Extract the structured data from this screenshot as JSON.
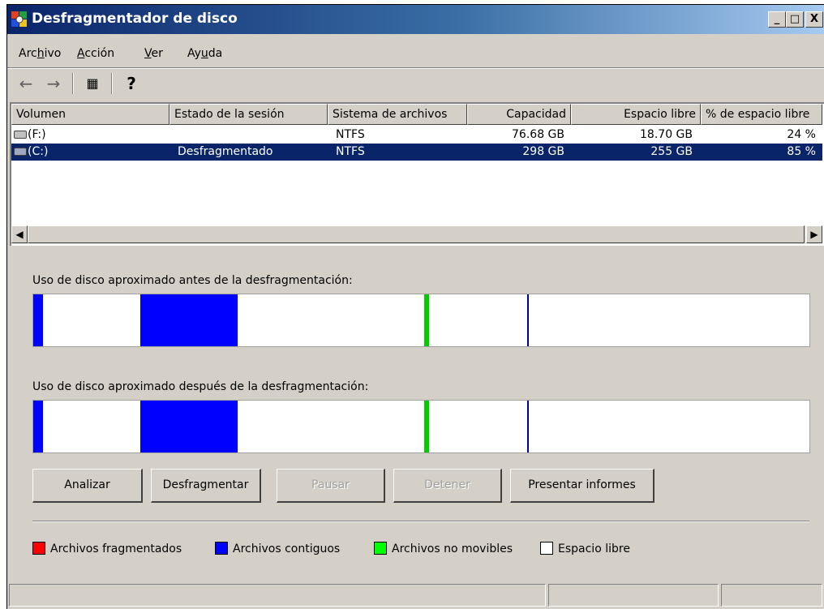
{
  "window": {
    "title": "Desfragmentador de disco",
    "controls": {
      "minimize": "_",
      "maximize": "□",
      "close": "X"
    }
  },
  "menu": [
    {
      "pre": "Arc",
      "u": "h",
      "post": "ivo"
    },
    {
      "pre": "",
      "u": "A",
      "post": "cción"
    },
    {
      "pre": "",
      "u": "V",
      "post": "er"
    },
    {
      "pre": "Ay",
      "u": "u",
      "post": "da"
    }
  ],
  "toolbar": {
    "back_icon": "←",
    "forward_icon": "→",
    "properties_icon": "▦",
    "help_icon": "?"
  },
  "volumes": {
    "columns": [
      "Volumen",
      "Estado de la sesión",
      "Sistema de archivos",
      "Capacidad",
      "Espacio libre",
      "% de espacio libre"
    ],
    "rows": [
      {
        "volume": "(F:)",
        "status": "",
        "fs": "NTFS",
        "capacity": "76.68 GB",
        "free": "18.70 GB",
        "pct": "24 %"
      },
      {
        "volume": "(C:)",
        "status": "Desfragmentado",
        "fs": "NTFS",
        "capacity": "298 GB",
        "free": "255 GB",
        "pct": "85 %"
      }
    ],
    "scroll_left": "◀",
    "scroll_right": "▶"
  },
  "analysis": {
    "before_label": "Uso de disco aproximado antes de la desfragmentación:",
    "after_label": "Uso de disco aproximado después de la desfragmentación:"
  },
  "buttons": {
    "analyze": "Analizar",
    "defragment": "Desfragmentar",
    "pause": "Pausar",
    "stop": "Detener",
    "report": "Presentar informes"
  },
  "legend": {
    "fragmented": {
      "label": "Archivos fragmentados",
      "color": "#ff0000"
    },
    "contiguous": {
      "label": "Archivos contiguos",
      "color": "#0000ff"
    },
    "unmovable": {
      "label": "Archivos no movibles",
      "color": "#00ff00"
    },
    "free": {
      "label": "Espacio libre",
      "color": "#ffffff"
    }
  },
  "colors": {
    "titlebar": "#0a246a",
    "selection": "#0a246a",
    "window_bg": "#d4d0c8"
  }
}
